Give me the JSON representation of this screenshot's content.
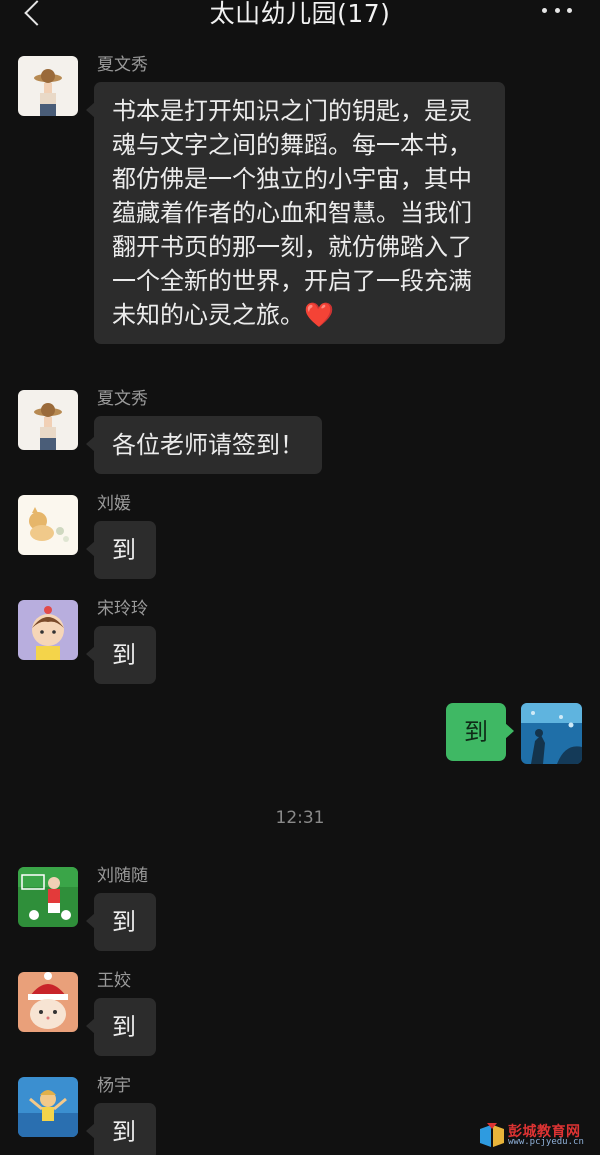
{
  "header": {
    "title": "太山幼儿园(17)"
  },
  "messages": [
    {
      "sender": "夏文秀",
      "text": "书本是打开知识之门的钥匙，是灵魂与文字之间的舞蹈。每一本书，都仿佛是一个独立的小宇宙，其中蕴藏着作者的心血和智慧。当我们翻开书页的那一刻，就仿佛踏入了一个全新的世界，开启了一段充满未知的心灵之旅。",
      "emoji": "❤️"
    },
    {
      "sender": "夏文秀",
      "text": "各位老师请签到！"
    },
    {
      "sender": "刘媛",
      "text": "到"
    },
    {
      "sender": "宋玲玲",
      "text": "到"
    }
  ],
  "self_message": {
    "text": "到"
  },
  "timestamp": "12:31",
  "messages_after": [
    {
      "sender": "刘随随",
      "text": "到"
    },
    {
      "sender": "王姣",
      "text": "到"
    },
    {
      "sender": "杨宇",
      "text": "到"
    }
  ],
  "watermark": {
    "text": "彭城教育网",
    "url": "www.pcjyedu.cn"
  },
  "colors": {
    "background": "#111111",
    "bubble_other": "#2c2c2c",
    "bubble_self": "#3fb864"
  }
}
